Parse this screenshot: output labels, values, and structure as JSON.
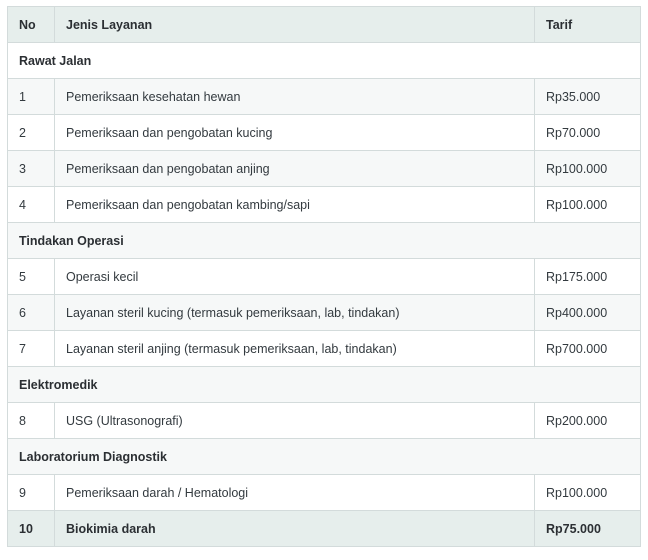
{
  "table": {
    "headers": {
      "no": "No",
      "name": "Jenis Layanan",
      "tarif": "Tarif"
    },
    "sections": [
      {
        "title": "Rawat Jalan",
        "rows": [
          {
            "no": "1",
            "name": "Pemeriksaan kesehatan hewan",
            "tarif": "Rp35.000"
          },
          {
            "no": "2",
            "name": "Pemeriksaan dan pengobatan kucing",
            "tarif": "Rp70.000"
          },
          {
            "no": "3",
            "name": "Pemeriksaan dan pengobatan anjing",
            "tarif": "Rp100.000"
          },
          {
            "no": "4",
            "name": "Pemeriksaan dan pengobatan kambing/sapi",
            "tarif": "Rp100.000"
          }
        ]
      },
      {
        "title": "Tindakan Operasi",
        "rows": [
          {
            "no": "5",
            "name": "Operasi kecil",
            "tarif": "Rp175.000"
          },
          {
            "no": "6",
            "name": "Layanan steril kucing (termasuk pemeriksaan, lab, tindakan)",
            "tarif": "Rp400.000"
          },
          {
            "no": "7",
            "name": "Layanan steril anjing (termasuk pemeriksaan, lab, tindakan)",
            "tarif": "Rp700.000"
          }
        ]
      },
      {
        "title": "Elektromedik",
        "rows": [
          {
            "no": "8",
            "name": "USG (Ultrasonografi)",
            "tarif": "Rp200.000"
          }
        ]
      },
      {
        "title": "Laboratorium Diagnostik",
        "rows": [
          {
            "no": "9",
            "name": "Pemeriksaan darah / Hematologi",
            "tarif": "Rp100.000"
          },
          {
            "no": "10",
            "name": "Biokimia darah",
            "tarif": "Rp75.000"
          }
        ]
      }
    ]
  },
  "colors": {
    "header_bg": "#e6eeec",
    "stripe_bg": "#f6f8f8",
    "border": "#d3dbdb"
  }
}
